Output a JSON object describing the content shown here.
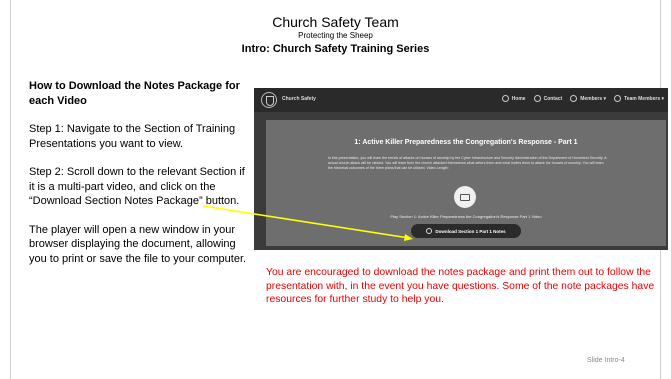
{
  "header": {
    "title": "Church Safety Team",
    "subtitle": "Protecting the Sheep",
    "series": "Intro: Church Safety Training Series"
  },
  "left": {
    "heading": "How to Download the Notes Package for each Video",
    "step1": "Step 1: Navigate to the Section of Training Presentations you want to view.",
    "step2": "Step 2: Scroll down to the relevant Section if it is a multi-part video, and click on the “Download Section Notes Package” button.",
    "step3": "The player will open a new window in your browser displaying the document, allowing you to print or save the file to your computer."
  },
  "website": {
    "brand": "Church Safety",
    "menu": [
      {
        "label": "Home",
        "icon": "home-icon"
      },
      {
        "label": "Contact",
        "icon": "contact-icon"
      },
      {
        "label": "Members ▾",
        "icon": "members-icon"
      },
      {
        "label": "Team Members ▾",
        "icon": "team-icon"
      }
    ],
    "hero_title": "1: Active Killer Preparedness the Congregation's Response - Part 1",
    "hero_desc": "In this presentation, you will learn the trends of attacks on houses of worship by the Cyber Infrastructure and Security Administration of the Department of Homeland Security. A actual church attack will be viewed. You will learn from the church attacked themselves what deters them and what invites them to attack the houses of worship. You will learn the historical outcomes of the three plans that can be utilized. Video Length:",
    "play_caption": "Play Section 1: Active Killer Preparedness the Congregation's Response Part 1 Video",
    "download_label": "Download Section 1 Part 1 Notes"
  },
  "note": "You are encouraged to download the notes package and print them out to follow the presentation with, in the event you have questions. Some of the note packages have resources for further study to help you.",
  "slide_number": "Slide Intro-4",
  "colors": {
    "accent_red": "#e60000",
    "arrow_yellow": "#ffff00"
  }
}
